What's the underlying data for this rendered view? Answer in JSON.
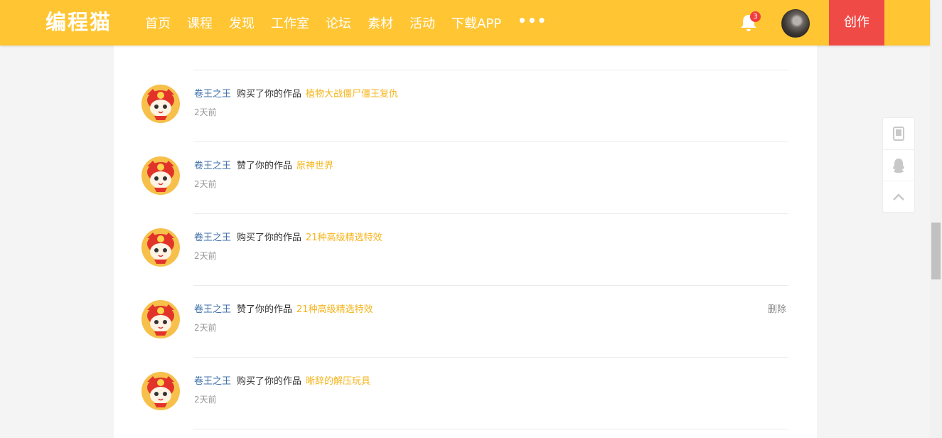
{
  "header": {
    "logo": "编程猫",
    "nav": [
      "首页",
      "课程",
      "发现",
      "工作室",
      "论坛",
      "素材",
      "活动",
      "下载APP"
    ],
    "more": "•••",
    "notification_count": "3",
    "create_label": "创作",
    "accent_color": "#ffc532"
  },
  "notifications": [
    {
      "user": "卷王之王",
      "action": "购买了你的作品",
      "work": "植物大战僵尸僵王复仇",
      "time": "2天前",
      "delete_label": ""
    },
    {
      "user": "卷王之王",
      "action": "赞了你的作品",
      "work": "原神世界",
      "time": "2天前",
      "delete_label": ""
    },
    {
      "user": "卷王之王",
      "action": "购买了你的作品",
      "work": "21种高级精选特效",
      "time": "2天前",
      "delete_label": ""
    },
    {
      "user": "卷王之王",
      "action": "赞了你的作品",
      "work": "21种高级精选特效",
      "time": "2天前",
      "delete_label": "删除"
    },
    {
      "user": "卷王之王",
      "action": "购买了你的作品",
      "work": "晰辞的解压玩具",
      "time": "2天前",
      "delete_label": ""
    }
  ],
  "side_tools": [
    "mobile-icon",
    "qq-icon",
    "back-to-top-icon"
  ]
}
